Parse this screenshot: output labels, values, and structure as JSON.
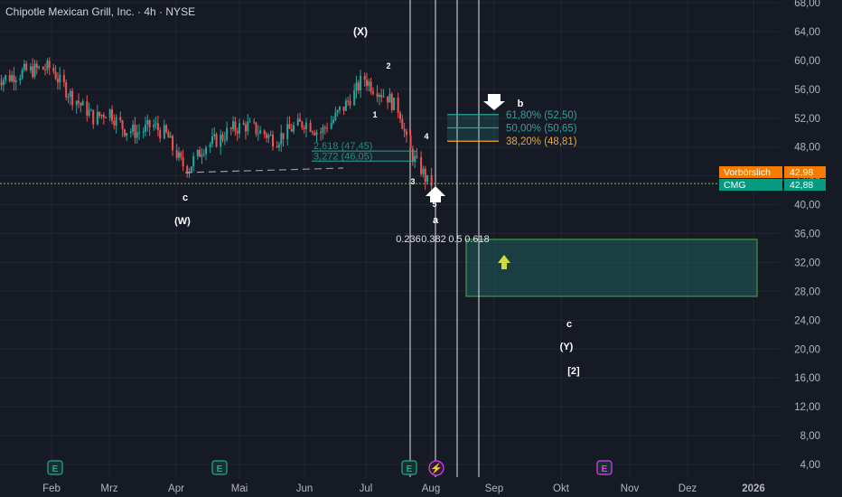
{
  "header": {
    "title": "Chipotle Mexican Grill, Inc. · 4h · NYSE"
  },
  "colors": {
    "background": "#161a25",
    "grid": "#232733",
    "axis_text": "#b2b5be",
    "up": "#26a69a",
    "down": "#ef5350",
    "fib_green": "#26a69a",
    "fib_orange": "#f5a623",
    "target_box": "#1f5d5a",
    "target_border": "#4caf50",
    "event_earnings": "#26a69a",
    "event_dividend": "#e040fb",
    "vorboerslich": "#f57c00",
    "cmg": "#089981"
  },
  "chart_data": {
    "type": "candlestick",
    "y_axis": {
      "range": [
        3,
        68
      ],
      "ticks": [
        "68,00",
        "64,00",
        "60,00",
        "56,00",
        "52,00",
        "48,00",
        "44,00",
        "40,00",
        "36,00",
        "32,00",
        "28,00",
        "24,00",
        "20,00",
        "16,00",
        "12,00",
        "8,00",
        "4,00"
      ]
    },
    "x_axis": {
      "ticks": [
        "Feb",
        "Mrz",
        "Apr",
        "Mai",
        "Jun",
        "Jul",
        "Aug",
        "Sep",
        "Okt",
        "Nov",
        "Dez",
        "2026"
      ]
    },
    "price_path": [
      {
        "date": "2025-01-10",
        "close": 57.5
      },
      {
        "date": "2025-01-20",
        "close": 58.5
      },
      {
        "date": "2025-02-01",
        "close": 59.0
      },
      {
        "date": "2025-02-08",
        "close": 56.0
      },
      {
        "date": "2025-02-15",
        "close": 54.0
      },
      {
        "date": "2025-02-22",
        "close": 52.0
      },
      {
        "date": "2025-03-01",
        "close": 53.0
      },
      {
        "date": "2025-03-08",
        "close": 50.5
      },
      {
        "date": "2025-03-15",
        "close": 50.0
      },
      {
        "date": "2025-03-22",
        "close": 51.0
      },
      {
        "date": "2025-03-29",
        "close": 49.5
      },
      {
        "date": "2025-04-04",
        "close": 46.0
      },
      {
        "date": "2025-04-08",
        "close": 45.0
      },
      {
        "date": "2025-04-15",
        "close": 48.0
      },
      {
        "date": "2025-04-22",
        "close": 49.0
      },
      {
        "date": "2025-04-29",
        "close": 50.5
      },
      {
        "date": "2025-05-06",
        "close": 51.0
      },
      {
        "date": "2025-05-13",
        "close": 50.0
      },
      {
        "date": "2025-05-20",
        "close": 49.0
      },
      {
        "date": "2025-05-27",
        "close": 50.5
      },
      {
        "date": "2025-06-03",
        "close": 51.5
      },
      {
        "date": "2025-06-10",
        "close": 50.0
      },
      {
        "date": "2025-06-17",
        "close": 52.0
      },
      {
        "date": "2025-06-24",
        "close": 54.5
      },
      {
        "date": "2025-07-01",
        "close": 57.5
      },
      {
        "date": "2025-07-05",
        "close": 56.5
      },
      {
        "date": "2025-07-12",
        "close": 55.0
      },
      {
        "date": "2025-07-18",
        "close": 53.0
      },
      {
        "date": "2025-07-23",
        "close": 47.5
      },
      {
        "date": "2025-07-28",
        "close": 45.0
      },
      {
        "date": "2025-08-01",
        "close": 43.0
      }
    ],
    "wave_labels": [
      "(X)",
      "2",
      "1",
      "4",
      "3",
      "5",
      "a",
      "b",
      "c",
      "(W)",
      "c",
      "(Y)",
      "[2]"
    ],
    "fib_retracement": [
      {
        "label": "61,80% (52,50)",
        "value": 52.5,
        "color": "fib_green"
      },
      {
        "label": "50,00% (50,65)",
        "value": 50.65,
        "color": "fib_green"
      },
      {
        "label": "38,20% (48,81)",
        "value": 48.81,
        "color": "fib_orange"
      }
    ],
    "fib_extension": [
      {
        "label": "2,618 (47,45)",
        "value": 47.45
      },
      {
        "label": "3,272 (46,05)",
        "value": 46.05
      }
    ],
    "fib_time_labels": [
      "0.236",
      "0.382",
      "0.5",
      "0.618"
    ],
    "target_zone": {
      "top": 35.2,
      "bottom": 27.3
    },
    "price_tags": [
      {
        "label": "Vorbörslich",
        "value": "42,98",
        "numeric": 42.98,
        "color": "vorboerslich"
      },
      {
        "label": "CMG",
        "value": "42,88",
        "numeric": 42.88,
        "color": "cmg"
      }
    ],
    "events": [
      "E",
      "E",
      "E",
      "⚡",
      "E"
    ]
  }
}
